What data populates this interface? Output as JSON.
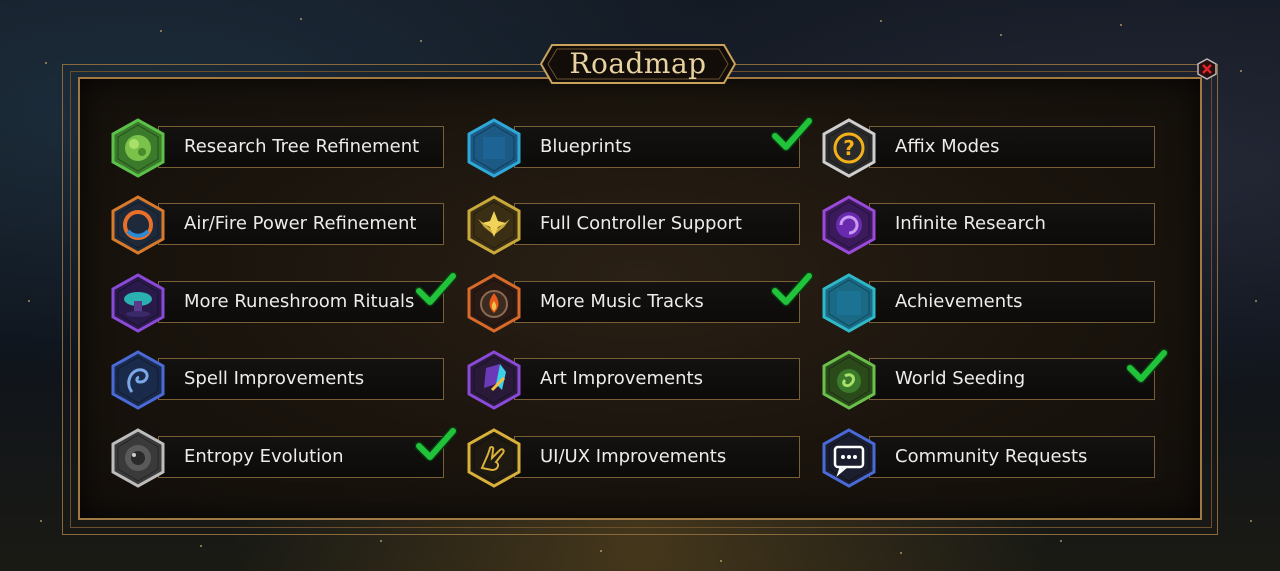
{
  "title": "Roadmap",
  "items": [
    {
      "label": "Research Tree Refinement",
      "icon": "green-seed-icon",
      "border": "#5cc04a",
      "inner": "#3a7a2a",
      "done": false
    },
    {
      "label": "Blueprints",
      "icon": "blueprint-icon",
      "border": "#2fa8d8",
      "inner": "#1c5a86",
      "done": true
    },
    {
      "label": "Affix Modes",
      "icon": "question-mark-icon",
      "border": "#cfcfcf",
      "inner": "#2a2a2a",
      "done": false
    },
    {
      "label": "Air/Fire Power Refinement",
      "icon": "fire-ring-icon",
      "border": "#d87a2a",
      "inner": "#1e2a3a",
      "done": false
    },
    {
      "label": "Full Controller Support",
      "icon": "golden-wings-icon",
      "border": "#c9a93a",
      "inner": "#3a2e14",
      "done": false
    },
    {
      "label": "Infinite Research",
      "icon": "purple-vortex-icon",
      "border": "#9a4ad8",
      "inner": "#3a1a5a",
      "done": false
    },
    {
      "label": "More Runeshroom Rituals",
      "icon": "runeshroom-icon",
      "border": "#8a4ad8",
      "inner": "#2a1a4a",
      "done": true
    },
    {
      "label": "More Music Tracks",
      "icon": "flame-gear-icon",
      "border": "#d86a2a",
      "inner": "#2a1a14",
      "done": true
    },
    {
      "label": "Achievements",
      "icon": "achievement-icon",
      "border": "#2fb8c8",
      "inner": "#1a6a86",
      "done": false
    },
    {
      "label": "Spell Improvements",
      "icon": "spiral-spell-icon",
      "border": "#4a6ad8",
      "inner": "#1a2a4a",
      "done": false
    },
    {
      "label": "Art Improvements",
      "icon": "crystal-brush-icon",
      "border": "#8a4ad8",
      "inner": "#2a1a3a",
      "done": false
    },
    {
      "label": "World Seeding",
      "icon": "world-seed-icon",
      "border": "#6ac04a",
      "inner": "#2a4a1a",
      "done": true
    },
    {
      "label": "Entropy Evolution",
      "icon": "entropy-icon",
      "border": "#bdbdbd",
      "inner": "#3a3a3a",
      "done": true
    },
    {
      "label": "UI/UX Improvements",
      "icon": "hand-icon",
      "border": "#d8b03a",
      "inner": "#1e1a12",
      "done": false
    },
    {
      "label": "Community Requests",
      "icon": "chat-bubble-icon",
      "border": "#4a6ad8",
      "inner": "#1a1e2e",
      "done": false
    }
  ],
  "colors": {
    "check": "#21c33a",
    "frame": "#a07a42",
    "close": "#e0242a"
  }
}
